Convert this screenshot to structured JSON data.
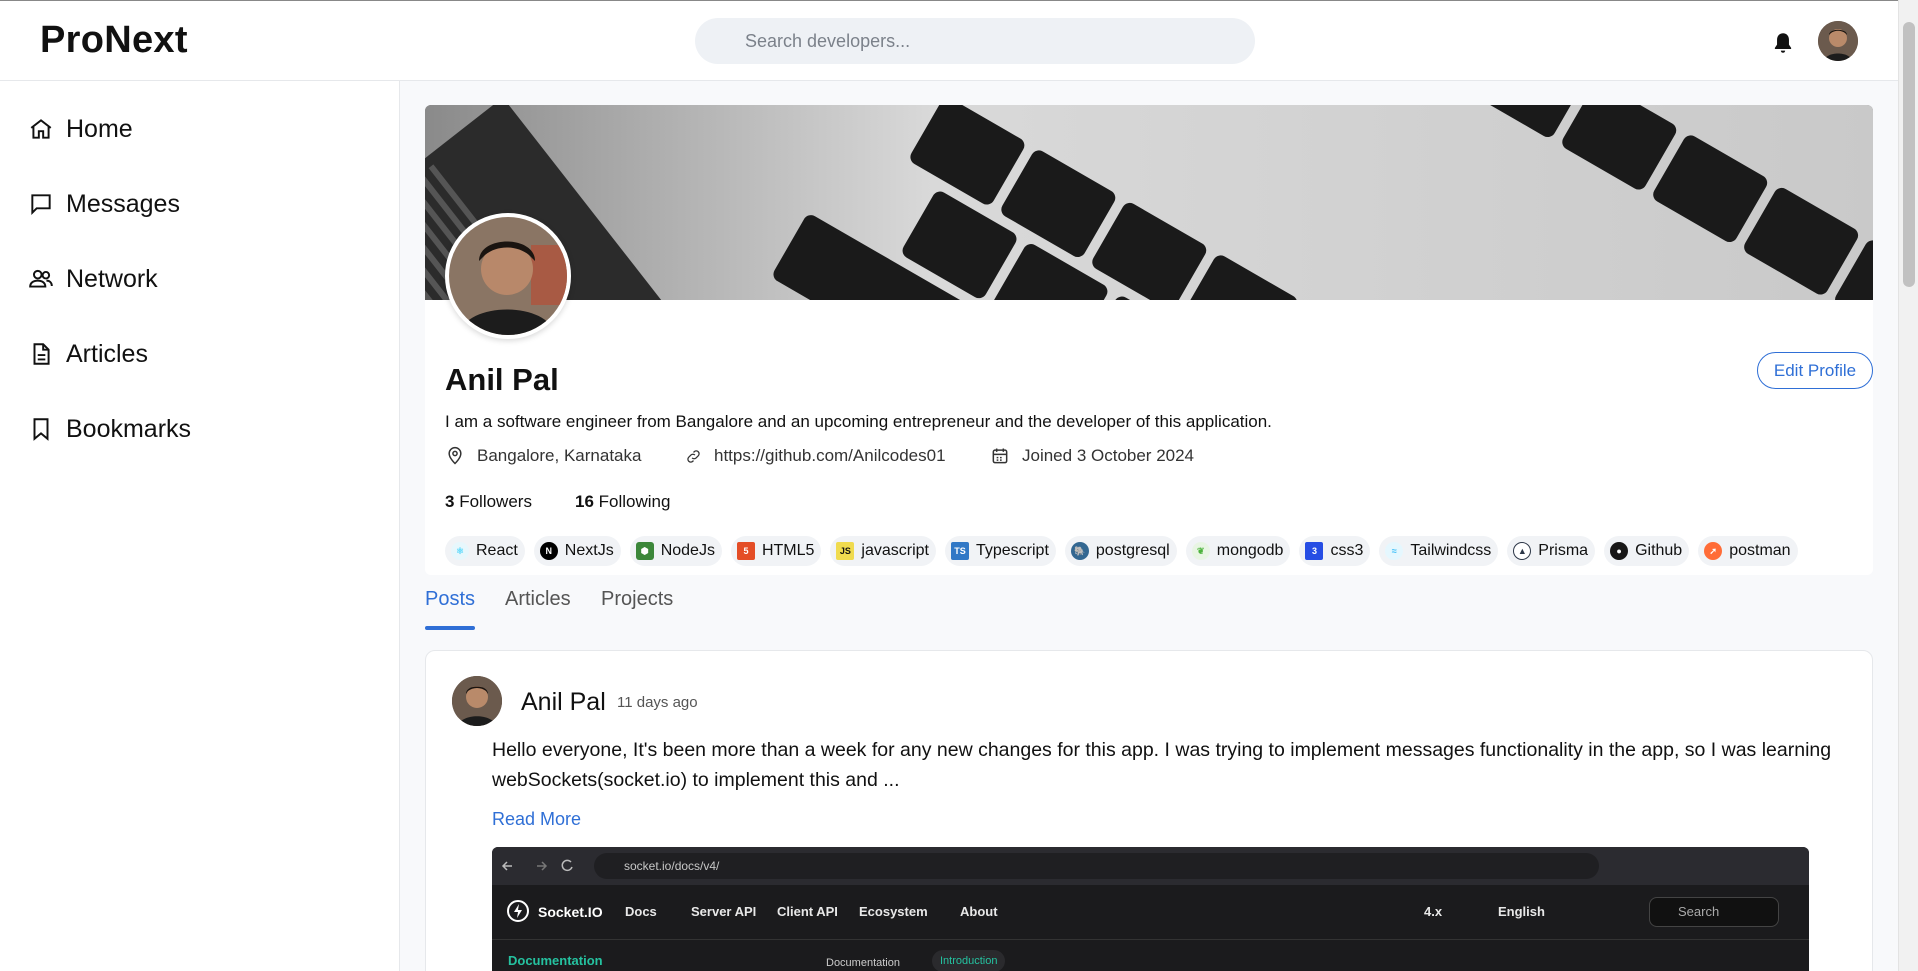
{
  "app": {
    "logo": "ProNext"
  },
  "search": {
    "placeholder": "Search developers..."
  },
  "topbar_icons": [
    "bell-icon",
    "avatar"
  ],
  "sidebar": {
    "items": [
      {
        "label": "Home",
        "icon": "home-icon"
      },
      {
        "label": "Messages",
        "icon": "message-icon"
      },
      {
        "label": "Network",
        "icon": "users-icon"
      },
      {
        "label": "Articles",
        "icon": "document-icon"
      },
      {
        "label": "Bookmarks",
        "icon": "bookmark-icon"
      }
    ]
  },
  "profile": {
    "name": "Anil Pal",
    "bio": "I am a software engineer from Bangalore and an upcoming entrepreneur and the developer of this application.",
    "location": "Bangalore, Karnataka",
    "website": "https://github.com/Anilcodes01",
    "joined": "Joined 3 October 2024",
    "followers_count": "3",
    "followers_label": "Followers",
    "following_count": "16",
    "following_label": "Following",
    "edit_label": "Edit Profile",
    "skills": [
      {
        "label": "React",
        "color": "#61dafb"
      },
      {
        "label": "NextJs",
        "color": "#000000"
      },
      {
        "label": "NodeJs",
        "color": "#3c873a"
      },
      {
        "label": "HTML5",
        "color": "#e44d26"
      },
      {
        "label": "javascript",
        "color": "#f0db4f"
      },
      {
        "label": "Typescript",
        "color": "#3178c6"
      },
      {
        "label": "postgresql",
        "color": "#336791"
      },
      {
        "label": "mongodb",
        "color": "#4db33d"
      },
      {
        "label": "css3",
        "color": "#264de4"
      },
      {
        "label": "Tailwindcss",
        "color": "#38bdf8"
      },
      {
        "label": "Prisma",
        "color": "#2d3748"
      },
      {
        "label": "Github",
        "color": "#181717"
      },
      {
        "label": "postman",
        "color": "#ff6c37"
      }
    ]
  },
  "tabs": [
    {
      "label": "Posts",
      "active": true
    },
    {
      "label": "Articles",
      "active": false
    },
    {
      "label": "Projects",
      "active": false
    }
  ],
  "post": {
    "author": "Anil Pal",
    "time": "11 days ago",
    "text": "Hello everyone, It's been more than a week for any new changes for this app. I was trying to implement messages functionality in the app, so I was learning webSockets(socket.io) to implement this and ...",
    "read_more": "Read More",
    "screenshot": {
      "url": "socket.io/docs/v4/",
      "brand": "Socket.IO",
      "nav": [
        "Docs",
        "Server API",
        "Client API",
        "Ecosystem",
        "About"
      ],
      "version": "4.x",
      "language": "English",
      "search": "Search",
      "sidebar_title": "Documentation",
      "crumb_docs": "Documentation",
      "crumb_active": "Introduction"
    }
  },
  "colors": {
    "accent": "#2f6fd6",
    "text": "#111111",
    "muted": "#555555"
  }
}
